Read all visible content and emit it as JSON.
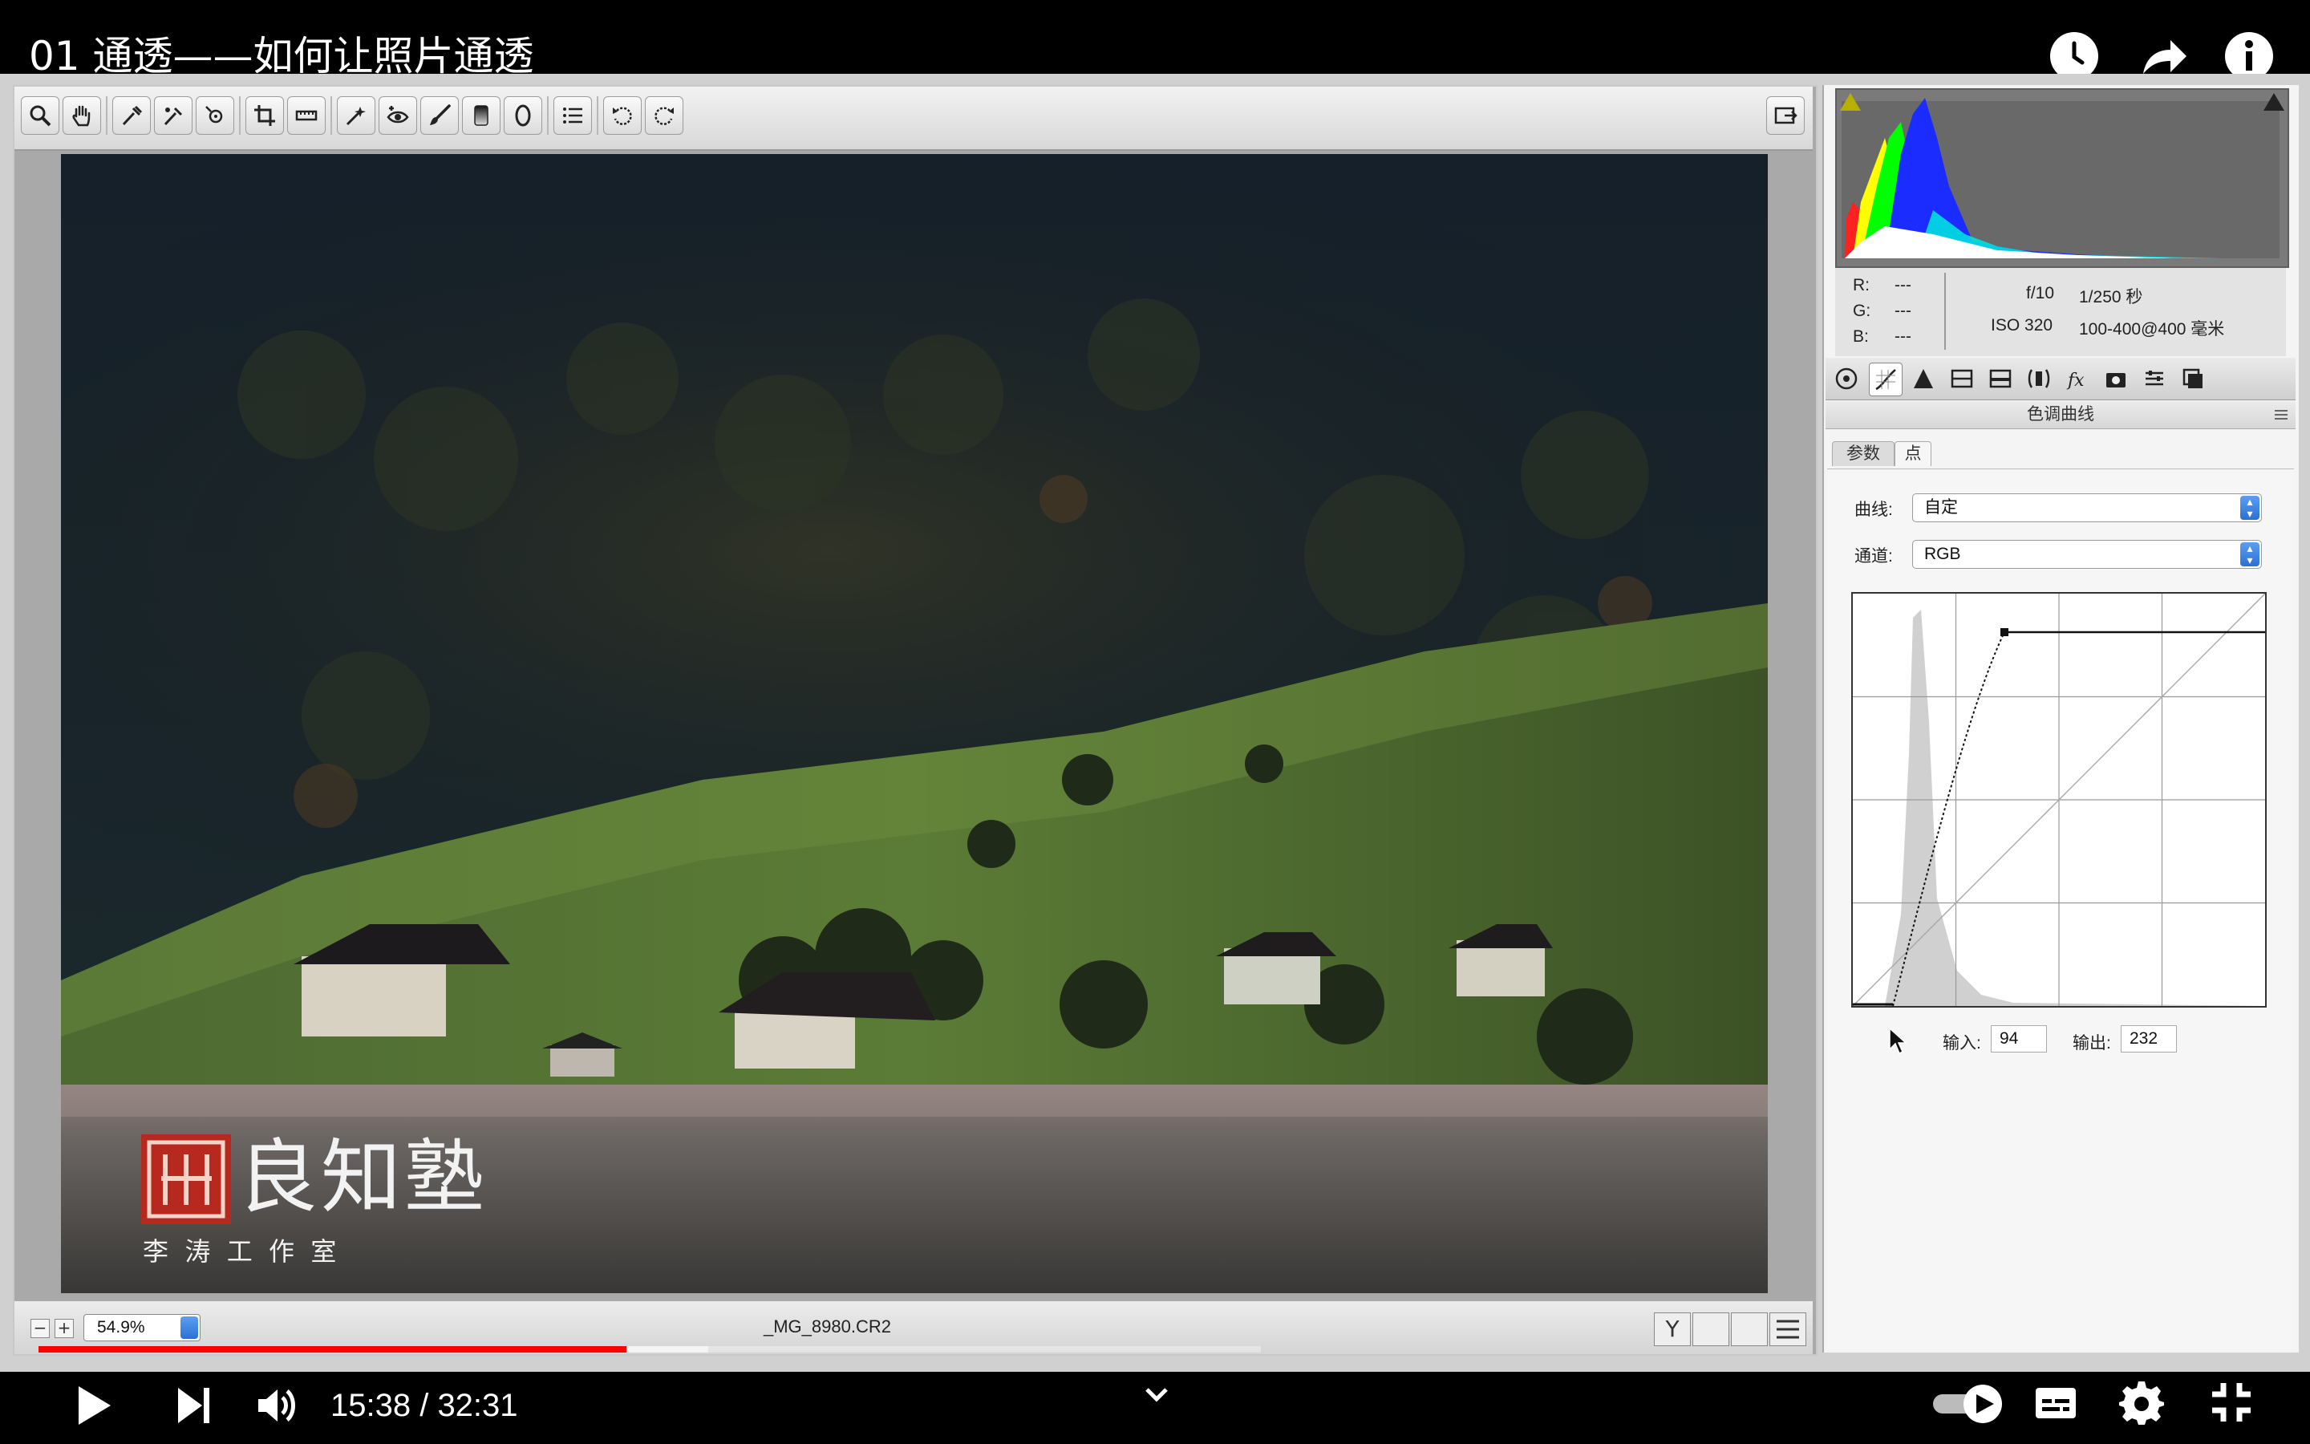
{
  "video": {
    "title": "01 通透——如何让照片通透",
    "current_time": "15:38",
    "duration": "32:31",
    "time_display": "15:38 / 32:31",
    "progress": 0.481,
    "buffered": 0.548
  },
  "player_icons": {
    "top": [
      "watch-later-icon",
      "share-icon",
      "info-icon"
    ],
    "bottom_left": [
      "play-icon",
      "next-icon",
      "volume-icon"
    ],
    "bottom_right": [
      "autoplay-toggle-icon",
      "subtitles-icon",
      "settings-icon",
      "exit-fullscreen-icon"
    ],
    "center": "chevron-down-icon"
  },
  "toolbar": {
    "tools": [
      "zoom-icon",
      "hand-icon",
      "white-balance-icon",
      "color-sampler-icon",
      "target-adjust-icon",
      "crop-icon",
      "straighten-icon",
      "spot-removal-icon",
      "red-eye-icon",
      "adjustment-brush-icon",
      "graduated-filter-icon",
      "radial-filter-icon",
      "preferences-icon",
      "rotate-left-icon",
      "rotate-right-icon"
    ],
    "right_icon": "fullscreen-toggle-icon"
  },
  "bottom_bar": {
    "zoom": "54.9%",
    "filename": "_MG_8980.CR2"
  },
  "watermark": {
    "brand": "良知塾",
    "subtitle": "李  涛  工  作  室"
  },
  "info": {
    "r_label": "R:",
    "r_value": "---",
    "g_label": "G:",
    "g_value": "---",
    "b_label": "B:",
    "b_value": "---",
    "aperture": "f/10",
    "shutter": "1/250 秒",
    "iso": "ISO 320",
    "lens": "100-400@400 毫米"
  },
  "panel": {
    "title": "色调曲线",
    "tabs": [
      "参数",
      "点"
    ],
    "active_tab": "点",
    "curve_label": "曲线:",
    "curve_value": "自定",
    "channel_label": "通道:",
    "channel_value": "RGB",
    "input_label": "输入:",
    "input_value": "94",
    "output_label": "输出:",
    "output_value": "232"
  },
  "colors": {
    "progress": "#ff0000",
    "accent_select": "#2c6fd6"
  }
}
